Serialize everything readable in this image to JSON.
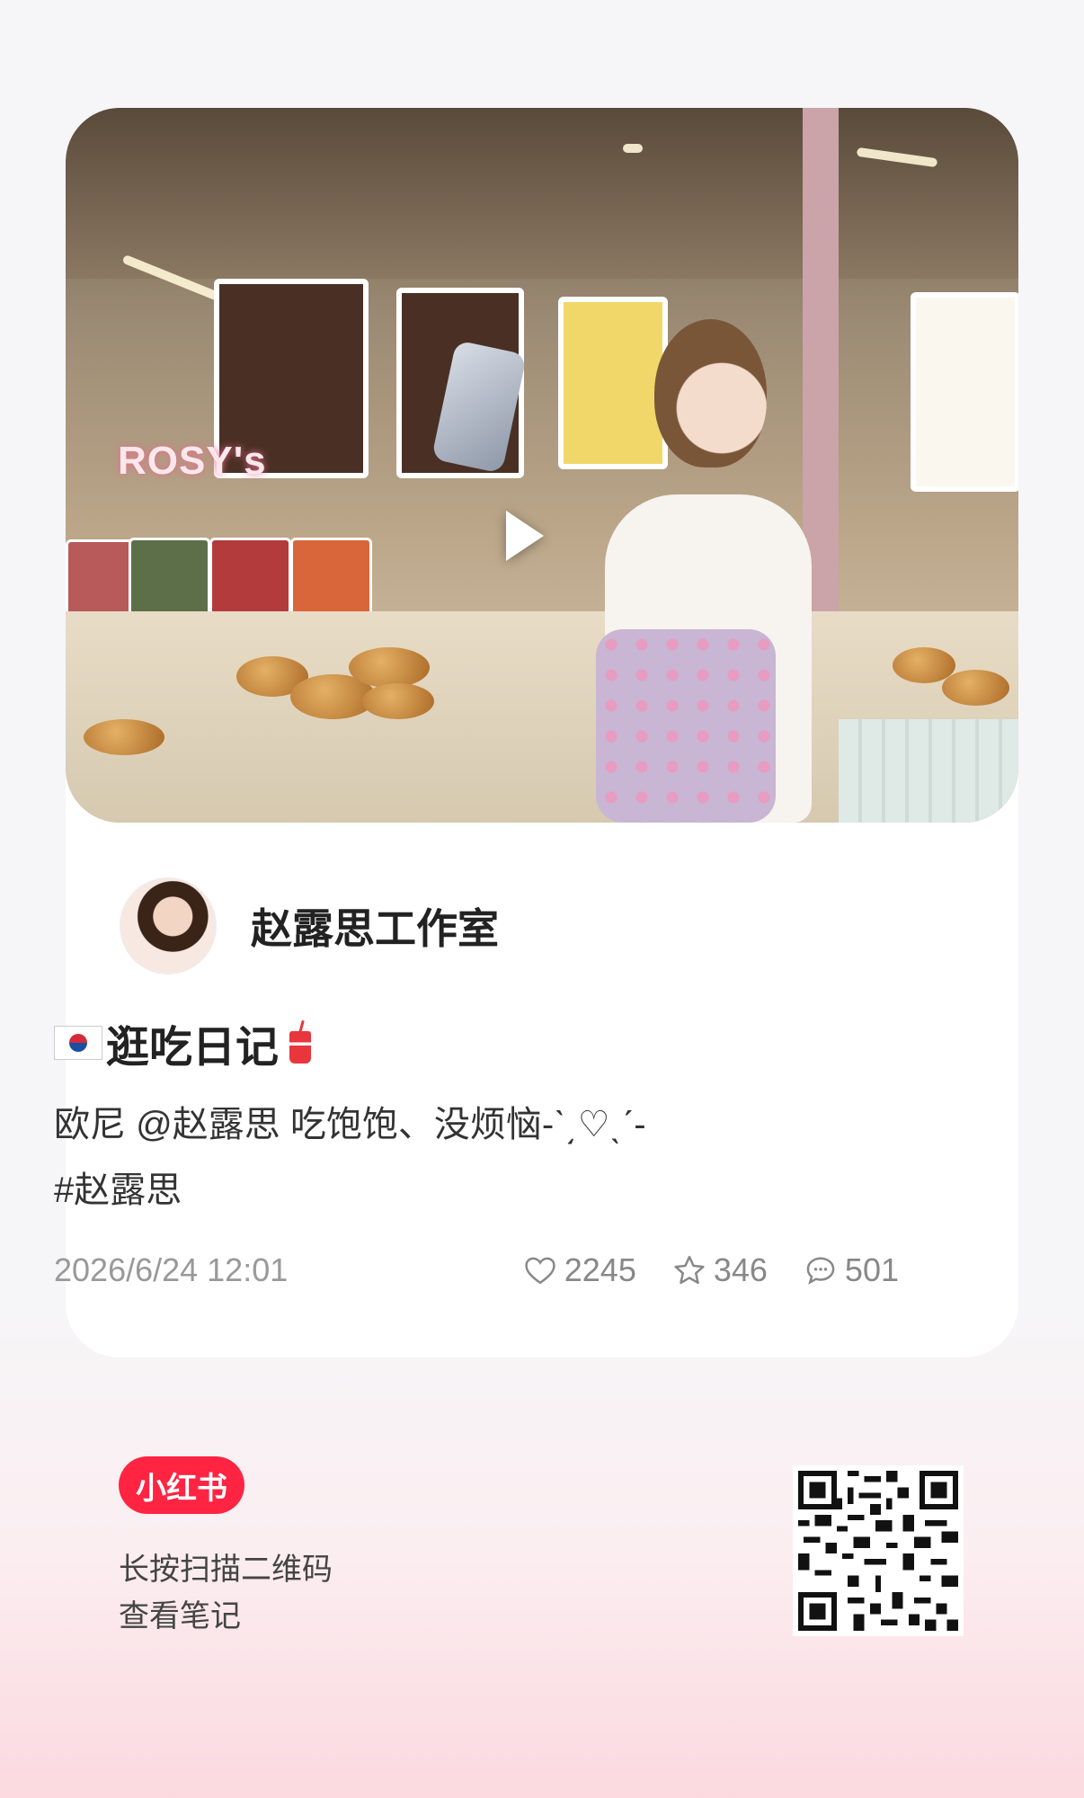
{
  "media": {
    "overlay_text": "ROSY's",
    "play_icon": "play-icon"
  },
  "author": {
    "name": "赵露思工作室"
  },
  "note": {
    "title": "逛吃日记",
    "desc_line1": "欧尼 @赵露思 吃饱饱、没烦恼-ˋ͵♡ˎˊ-",
    "desc_line2": "#赵露思"
  },
  "meta": {
    "date": "2026/6/24 12:01",
    "likes": "2245",
    "collects": "346",
    "comments": "501"
  },
  "footer": {
    "brand": "小红书",
    "scan_line1": "长按扫描二维码",
    "scan_line2": "查看笔记"
  },
  "colors": {
    "brand": "#ff2442",
    "card": "#ffffff",
    "background_bottom": "#fbd9df"
  }
}
